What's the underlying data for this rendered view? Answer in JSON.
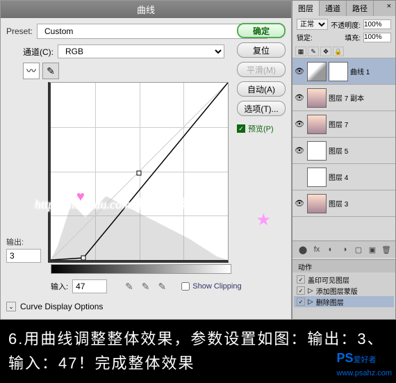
{
  "dialog": {
    "title": "曲线",
    "preset_label": "Preset:",
    "preset_value": "Custom",
    "channel_label": "通道(C):",
    "channel_value": "RGB",
    "output_label": "输出:",
    "output_value": "3",
    "input_label": "输入:",
    "input_value": "47",
    "show_clipping": "Show Clipping",
    "expand_label": "Curve Display Options"
  },
  "buttons": {
    "ok": "确定",
    "reset": "复位",
    "smooth": "平滑(M)",
    "auto": "自动(A)",
    "options": "选项(T)...",
    "preview": "预览(P)"
  },
  "panel": {
    "tabs": [
      "图层",
      "通道",
      "路径"
    ],
    "blend_mode": "正常",
    "opacity_label": "不透明度:",
    "opacity_value": "100%",
    "fill_label": "填充:",
    "fill_value": "100%",
    "lock_label": "锁定:"
  },
  "layers": [
    {
      "name": "曲线 1",
      "type": "curves",
      "selected": true,
      "visible": true
    },
    {
      "name": "图层 7 副本",
      "type": "portrait",
      "selected": false,
      "visible": true
    },
    {
      "name": "图层 7",
      "type": "portrait",
      "selected": false,
      "visible": true
    },
    {
      "name": "图层 5",
      "type": "normal",
      "selected": false,
      "visible": true
    },
    {
      "name": "图层 4",
      "type": "normal",
      "selected": false,
      "visible": false
    },
    {
      "name": "图层 3",
      "type": "portrait",
      "selected": false,
      "visible": true
    }
  ],
  "actions": {
    "tab": "动作",
    "items": [
      "盖印可见图层",
      "添加图层蒙版",
      "删除图层"
    ]
  },
  "watermark": {
    "text": "http://hi.baidu.com/静静一起说.html"
  },
  "caption": {
    "text": "6.用曲线调整整体效果，参数设置如图：输出：3、输入：47！完成整体效果",
    "logo_brand": "PS",
    "logo_text": "爱好者",
    "logo_url": "www.psahz.com"
  },
  "chart_data": {
    "type": "line",
    "title": "曲线",
    "xlabel": "输入",
    "ylabel": "输出",
    "xlim": [
      0,
      255
    ],
    "ylim": [
      0,
      255
    ],
    "series": [
      {
        "name": "RGB",
        "points": [
          [
            0,
            0
          ],
          [
            47,
            3
          ],
          [
            255,
            255
          ]
        ]
      }
    ]
  }
}
